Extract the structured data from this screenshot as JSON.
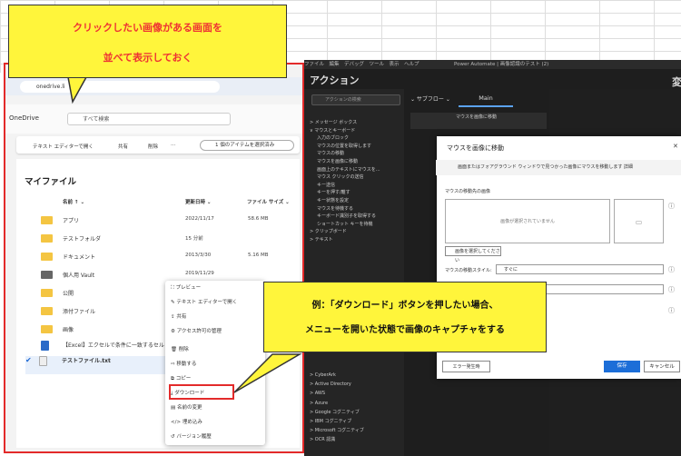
{
  "callout_top": {
    "line1": "クリックしたい画像がある画面を",
    "line2": "並べて表示しておく"
  },
  "callout_bottom": {
    "line1": "例：「ダウンロード」ボタンを押したい場合、",
    "line2": "メニューを開いた状態で画像のキャプチャをする"
  },
  "browser": {
    "url": "onedrive.li",
    "od_label": "OneDrive",
    "search_placeholder": "すべて検索",
    "cmd_edit": "テキスト エディターで開く",
    "cmd_share": "共有",
    "cmd_delete": "削除",
    "cmd_more": "···",
    "selected_pill": "1 個のアイテムを選択済み",
    "title": "マイファイル",
    "col_name": "名前 ↑ ⌄",
    "col_date": "更新日時 ⌄",
    "col_size": "ファイル サイズ ⌄",
    "files": [
      {
        "name": "アプリ",
        "date": "2022/11/17",
        "size": "58.6 MB"
      },
      {
        "name": "テストフォルダ",
        "date": "15 分前",
        "size": ""
      },
      {
        "name": "ドキュメント",
        "date": "2013/3/30",
        "size": "5.16 MB"
      },
      {
        "name": "個人用 Vault",
        "date": "2019/11/29",
        "size": ""
      },
      {
        "name": "公開",
        "date": "",
        "size": ""
      },
      {
        "name": "添付ファイル",
        "date": "",
        "size": ""
      },
      {
        "name": "画像",
        "date": "",
        "size": ""
      },
      {
        "name": "【Excel】エクセルで条件に一致するセル",
        "date": "",
        "size": ""
      },
      {
        "name": "テストファイル.txt",
        "date": "",
        "size": ""
      }
    ],
    "menu": [
      "プレビュー",
      "テキスト エディターで開く",
      "共有",
      "アクセス許可の管理",
      "削除",
      "移動する",
      "コピー",
      "ダウンロード",
      "名前の変更",
      "埋め込み",
      "バージョン履歴"
    ]
  },
  "pa": {
    "titlebar": "ファイル　編集　デバッグ　ツール　表示　ヘルプ　　　　　　　Power Automate | 画像認識のテスト (2)",
    "actions_title": "アクション",
    "search_placeholder": "アクションの検索",
    "tree": "> メッセージ ボックス\n∨ マウスとキーボード\n     入力のブロック\n     マウスの位置を取得します\n     マウスの移動\n     マウスを画像に移動\n     画面上のテキストにマウスを...\n     マウス クリックの送信\n     キー送信\n     キーを押す/離す\n     キー状態を設定\n     マウスを待機する\n     キーボード識別子を取得する\n     ショートカット キーを待機\n> クリップボード\n> テキスト",
    "tree2": "> CyberArk\n> Active Directory\n> AWS\n> Azure\n> Google コグニティブ\n> IBM コグニティブ\n> Microsoft コグニティブ\n> OCR 認識",
    "subflow": "⌄ サブフロー ⌄",
    "main_tab": "Main",
    "step": "マウスを画像に移動",
    "right_title": "変",
    "dialog": {
      "title": "マウスを画像に移動",
      "close": "✕",
      "desc": "画面またはフォアグラウンド ウィンドウで見つかった画像にマウスを移動します 詳細",
      "img_label": "マウスの移動先の画像",
      "img_placeholder": "画像が選択されていません",
      "select_btn": "画像を選択してください",
      "style_label": "マウスの移動スタイル:",
      "style_value": "すぐに",
      "error_btn": "エラー発生時",
      "save": "保存",
      "cancel": "キャンセル"
    }
  }
}
